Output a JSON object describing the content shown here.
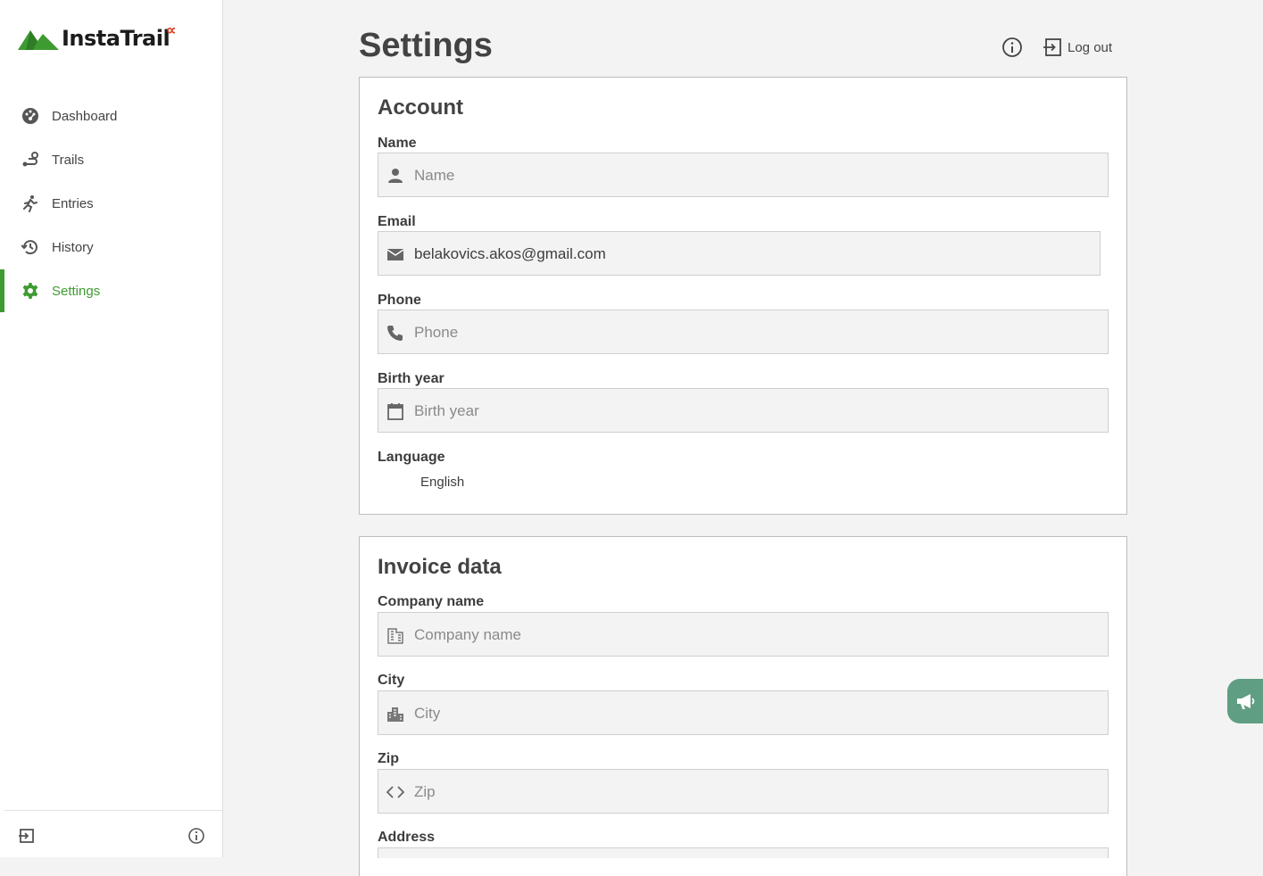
{
  "brand": {
    "name": "InstaTrail",
    "superscript": "∝",
    "accent": "#3e9b31",
    "alpha_color": "#e0442d"
  },
  "sidebar": {
    "items": [
      {
        "label": "Dashboard",
        "icon": "dashboard-icon"
      },
      {
        "label": "Trails",
        "icon": "route-icon"
      },
      {
        "label": "Entries",
        "icon": "running-person-icon"
      },
      {
        "label": "History",
        "icon": "history-icon"
      },
      {
        "label": "Settings",
        "icon": "gear-icon",
        "active": true
      }
    ],
    "footer": {
      "left_icon": "logout-icon",
      "right_icon": "info-icon"
    }
  },
  "header": {
    "title": "Settings",
    "logout_label": "Log out"
  },
  "account": {
    "heading": "Account",
    "name": {
      "label": "Name",
      "placeholder": "Name",
      "value": ""
    },
    "email": {
      "label": "Email",
      "value": "belakovics.akos@gmail.com"
    },
    "phone": {
      "label": "Phone",
      "placeholder": "Phone",
      "value": ""
    },
    "birth_year": {
      "label": "Birth year",
      "placeholder": "Birth year",
      "value": ""
    },
    "language": {
      "label": "Language",
      "value": "English"
    }
  },
  "invoice": {
    "heading": "Invoice data",
    "company": {
      "label": "Company name",
      "placeholder": "Company name"
    },
    "city": {
      "label": "City",
      "placeholder": "City"
    },
    "zip": {
      "label": "Zip",
      "placeholder": "Zip"
    },
    "address": {
      "label": "Address"
    }
  }
}
